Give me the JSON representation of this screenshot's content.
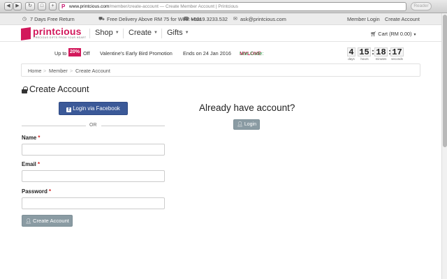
{
  "browser": {
    "back": "◀",
    "forward": "▶",
    "reload": "↻",
    "new_tab": "+",
    "url_domain": "www.printcious.com",
    "url_path": "/member/create-account — Create Member Account | Printcious",
    "reader_label": "Reader",
    "favicon": "P"
  },
  "topbar": {
    "returns": "7 Days Free Return",
    "delivery": "Free Delivery Above RM 75 for West Msia",
    "phone": "+6019.3233.532",
    "email": "ask@printcious.com",
    "member_login": "Member Login",
    "create_account": "Create Account"
  },
  "header": {
    "logo_text": "printcious",
    "logo_tagline": "PRECIOUS GIFTS FROM YOUR HEART",
    "menu": [
      {
        "label": "Shop"
      },
      {
        "label": "Create"
      },
      {
        "label": "Gifts"
      }
    ],
    "cart_label": "Cart (RM 0.00)"
  },
  "promo": {
    "up_to": "Up to",
    "percent": "20%",
    "off": "Off",
    "title": "Valentine's Early Bird Promotion",
    "ends": "Ends on 24 Jan 2016",
    "code_label": "Use Code:",
    "code": "MYLOVE",
    "countdown": {
      "days": "4",
      "hours": "15",
      "minutes": "18",
      "seconds": "17",
      "days_label": "days",
      "hours_label": "hours",
      "minutes_label": "minutes",
      "seconds_label": "seconds",
      "sep": ":"
    }
  },
  "breadcrumb": {
    "items": [
      "Home",
      "Member",
      "Create Account"
    ],
    "divider": ">"
  },
  "form": {
    "title": "Create Account",
    "facebook_label": "Login via Facebook",
    "or_text": "OR",
    "name_label": "Name",
    "email_label": "Email",
    "password_label": "Password",
    "required_mark": "*",
    "name_value": "",
    "email_value": "",
    "password_value": "",
    "submit_label": "Create Account"
  },
  "login_panel": {
    "heading": "Already have account?",
    "button_label": "Login"
  },
  "colors": {
    "brand": "#d2185b",
    "facebook": "#3b5998",
    "muted_button": "#8a9ba3",
    "code_green": "#2aa34a"
  }
}
